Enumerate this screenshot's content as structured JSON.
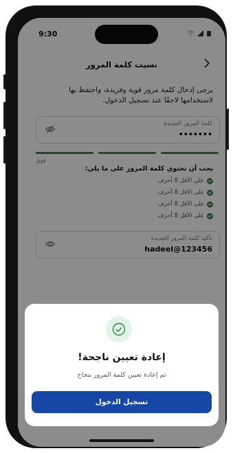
{
  "status_bar": {
    "time": "9:30"
  },
  "header": {
    "title": "نسيت كلمة المرور",
    "back_icon": "chevron-right-icon"
  },
  "intro": {
    "text": "يرجى إدخال كلمة مرور قوية وفريدة، واحتفظ بها لاستخدامها لاحقًا عند تسجيل الدخول."
  },
  "new_password": {
    "label": "كلمة المرور الجديدة",
    "value": "•••••••",
    "icon": "eye-off-icon"
  },
  "strength": {
    "label": "قوي",
    "segments_filled": 3,
    "segments_total": 3,
    "color": "#2e8a3f"
  },
  "requirements": {
    "title": "يجب أن تحتوي كلمة المرور على ما يلي:",
    "items": [
      "على الأقل 8 أحرف",
      "على الأقل 8 أحرف",
      "على الأقل 8 أحرف",
      "على الأقل 8 أحرف"
    ]
  },
  "confirm_password": {
    "label": "تأكيد كلمة المرور الجديدة",
    "value": "hadeel@123456",
    "icon": "eye-icon"
  },
  "dialog": {
    "icon": "check-circle-icon",
    "title": "إعادة تعيين ناجحة!",
    "subtitle": "تم إعادة تعيين كلمة المرور بنجاح",
    "button_label": "تسجيل الدخول",
    "button_color": "#1747a6"
  }
}
